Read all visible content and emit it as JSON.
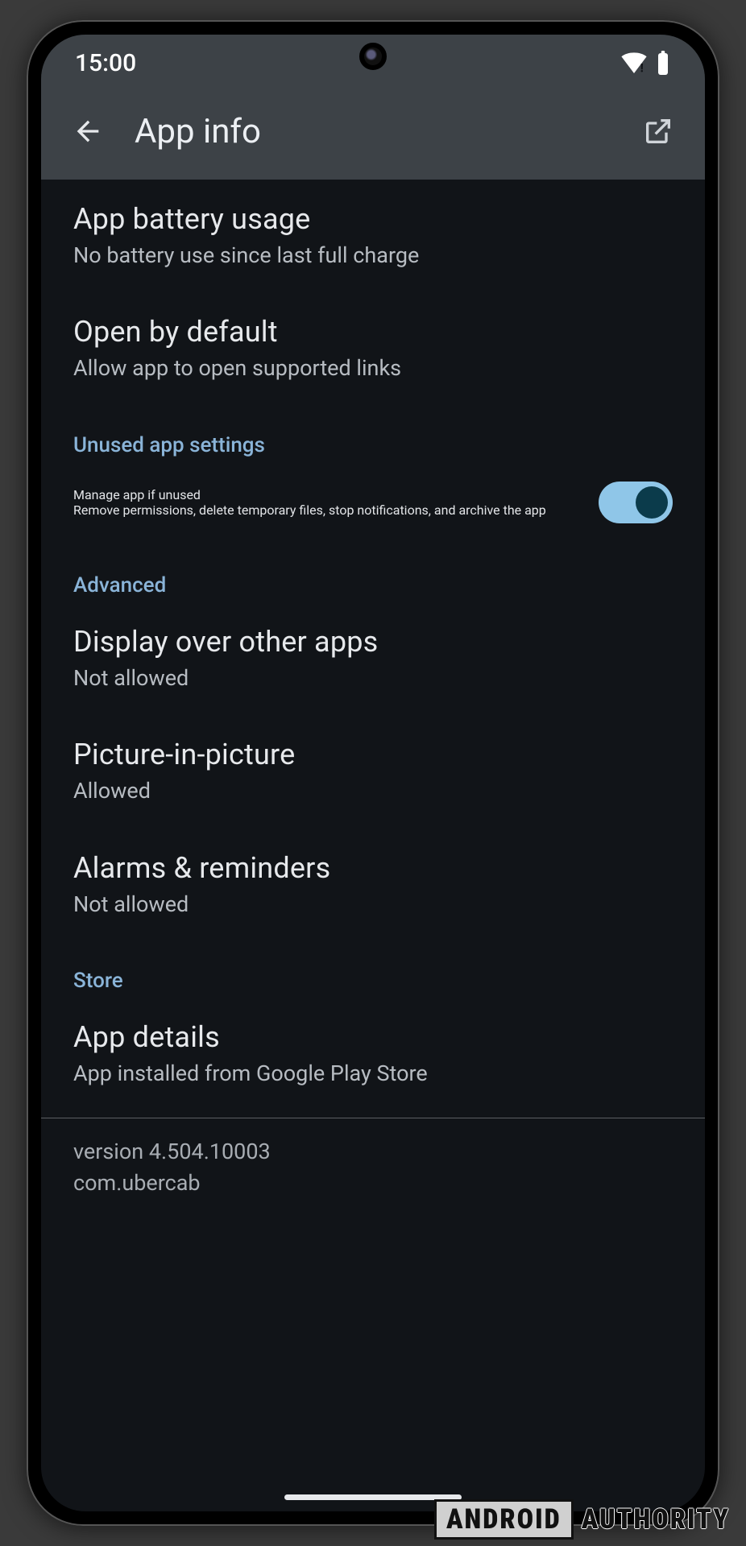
{
  "status": {
    "time": "15:00"
  },
  "appbar": {
    "title": "App info"
  },
  "rows": {
    "battery": {
      "title": "App battery usage",
      "sub": "No battery use since last full charge"
    },
    "default": {
      "title": "Open by default",
      "sub": "Allow app to open supported links"
    },
    "unused_section": "Unused app settings",
    "manage": {
      "title": "Manage app if unused",
      "sub": "Remove permissions, delete temporary files, stop notifications, and archive the app",
      "enabled": true
    },
    "advanced_section": "Advanced",
    "overlay": {
      "title": "Display over other apps",
      "sub": "Not allowed"
    },
    "pip": {
      "title": "Picture-in-picture",
      "sub": "Allowed"
    },
    "alarms": {
      "title": "Alarms & reminders",
      "sub": "Not allowed"
    },
    "store_section": "Store",
    "details": {
      "title": "App details",
      "sub": "App installed from Google Play Store"
    }
  },
  "footer": {
    "version": "version 4.504.10003",
    "package": "com.ubercab"
  },
  "watermark": {
    "a": "ANDROID",
    "b": "AUTHORITY"
  }
}
